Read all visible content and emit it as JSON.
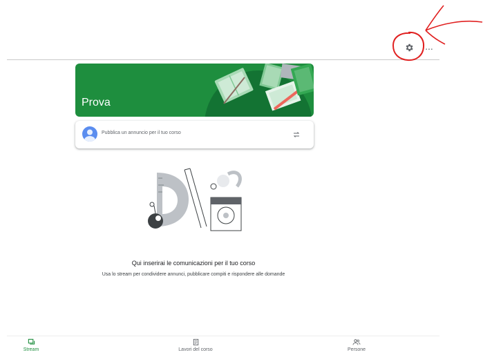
{
  "header": {
    "settings_icon": "gear-icon",
    "more_icon": "more-horizontal-icon",
    "more_label": "..."
  },
  "banner": {
    "title": "Prova",
    "color": "#1e8e3e"
  },
  "announce": {
    "placeholder": "Pubblica un annuncio per il tuo corso",
    "avatar_icon": "user-avatar-icon",
    "repost_icon": "repost-icon"
  },
  "empty_state": {
    "title": "Qui inserirai le comunicazioni per il tuo corso",
    "description": "Usa lo stream per condividere annunci, pubblicare compiti e rispondere alle domande"
  },
  "bottom_nav": {
    "items": [
      {
        "label": "Stream",
        "icon": "stream-icon",
        "active": true
      },
      {
        "label": "Lavori del corso",
        "icon": "classwork-icon",
        "active": false
      },
      {
        "label": "Persone",
        "icon": "people-icon",
        "active": false
      }
    ],
    "active_color": "#1e8e3e"
  },
  "annotation": {
    "color": "#e02020"
  }
}
